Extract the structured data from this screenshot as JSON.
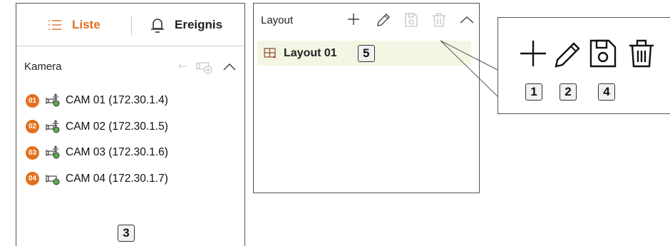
{
  "left_panel": {
    "tabs": [
      {
        "label": "Liste",
        "icon": "list-icon",
        "active": true
      },
      {
        "label": "Ereignis",
        "icon": "bell-icon",
        "active": false
      }
    ],
    "section_title": "Kamera",
    "cameras": [
      {
        "badge": "01",
        "label": "CAM 01 (172.30.1.4)",
        "icon": "ptz-camera-icon"
      },
      {
        "badge": "02",
        "label": "CAM 02 (172.30.1.5)",
        "icon": "ptz-camera-icon"
      },
      {
        "badge": "03",
        "label": "CAM 03 (172.30.1.6)",
        "icon": "ptz-camera-icon"
      },
      {
        "badge": "04",
        "label": "CAM 04 (172.30.1.7)",
        "icon": "camera-icon"
      }
    ],
    "callout_number": "3"
  },
  "layout_panel": {
    "title": "Layout",
    "toolbar_icons": [
      "plus-icon",
      "pencil-icon",
      "save-icon",
      "trash-icon",
      "chevron-up-icon"
    ],
    "items": [
      {
        "label": "Layout 01",
        "icon": "layout-grid-icon"
      }
    ],
    "callout_number": "5"
  },
  "zoom_callout": {
    "icons": [
      "plus-icon",
      "pencil-icon",
      "save-icon",
      "trash-icon"
    ],
    "numbers": [
      "1",
      "2",
      "4"
    ]
  },
  "colors": {
    "accent": "#e2701e",
    "selected_row": "#f4f6e4",
    "border": "#555555",
    "disabled_icon": "#c4c4c4"
  }
}
